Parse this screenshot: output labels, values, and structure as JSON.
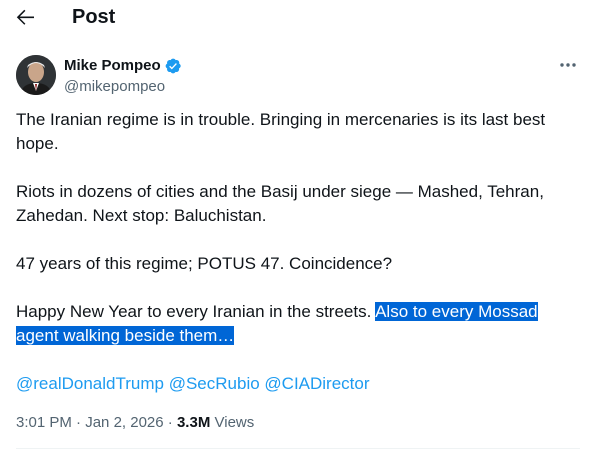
{
  "header": {
    "title": "Post",
    "back_icon": "arrow-left-icon"
  },
  "author": {
    "display_name": "Mike Pompeo",
    "handle": "@mikepompeo",
    "verified_color": "#1d9bf0"
  },
  "tweet": {
    "paragraph_1": "The Iranian regime is in trouble. Bringing in mercenaries is its last best hope.",
    "paragraph_2": "Riots in dozens of cities and the Basij under siege — Mashed, Tehran, Zahedan.  Next stop:  Baluchistan.",
    "paragraph_3": "47 years of this regime; POTUS 47.  Coincidence?",
    "paragraph_4_plain": "Happy New Year to every Iranian in the streets.  ",
    "paragraph_4_highlighted": "Also to every Mossad agent walking beside them…",
    "mentions": [
      "@realDonaldTrump",
      "@SecRubio",
      "@CIADirector"
    ],
    "highlight_color": "#0066d6",
    "link_color": "#1d9bf0"
  },
  "meta": {
    "time": "3:01 PM",
    "separator": "·",
    "date": "Jan 2, 2026",
    "views_count": "3.3M",
    "views_label": "Views"
  }
}
